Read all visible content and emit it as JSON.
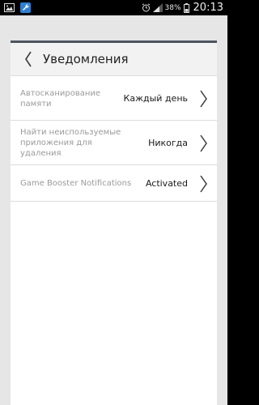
{
  "status_bar": {
    "left_icons": [
      "gallery-notification-icon",
      "wrench-notification-icon"
    ],
    "right_icons": [
      "alarm-clock-icon",
      "signal-strength-icon",
      "battery-icon"
    ],
    "battery_percent": "38%",
    "time": "20:13"
  },
  "header": {
    "title": "Уведомления"
  },
  "settings": [
    {
      "label": "Автосканирование памяти",
      "value": "Каждый день"
    },
    {
      "label": "Найти неиспользуемые приложения для удаления",
      "value": "Никогда"
    },
    {
      "label": "Game Booster Notifications",
      "value": "Activated"
    }
  ],
  "colors": {
    "background": "#e6e6e6",
    "card": "#ffffff",
    "header_bg": "#f2f2f2",
    "accent_bar": "#4d5461",
    "label_text": "#9a9a9a",
    "value_text": "#1a1a1a"
  }
}
